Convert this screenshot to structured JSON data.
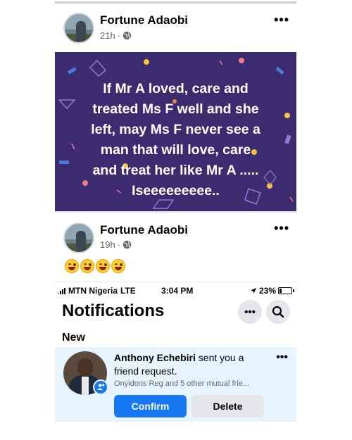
{
  "post1": {
    "author": "Fortune Adaobi",
    "time": "21h",
    "privacy_icon": "globe-icon",
    "more_label": "•••",
    "quote_lines": [
      "If Mr A loved, care and",
      "treated Ms F well and she",
      "left, may Ms F never see a",
      "man that will love, care",
      "and treat her like Mr A .....",
      "Iseeeeeeeee.."
    ],
    "background_color": "#3c2b6e"
  },
  "post2": {
    "author": "Fortune Adaobi",
    "time": "19h",
    "privacy_icon": "globe-icon",
    "more_label": "•••",
    "emoji_count": 4
  },
  "phone": {
    "status": {
      "carrier": "MTN Nigeria",
      "network": "LTE",
      "time": "3:04 PM",
      "battery": "23%",
      "battery_level": 0.23
    },
    "title": "Notifications",
    "more_label": "•••",
    "section": "New",
    "notification": {
      "name": "Anthony Echebiri",
      "text": "sent you a friend request.",
      "mutual": "Onyidons Reg and 5 other mutual frie...",
      "more_label": "•••",
      "confirm_label": "Confirm",
      "delete_label": "Delete"
    },
    "accent_color": "#1877f2"
  }
}
